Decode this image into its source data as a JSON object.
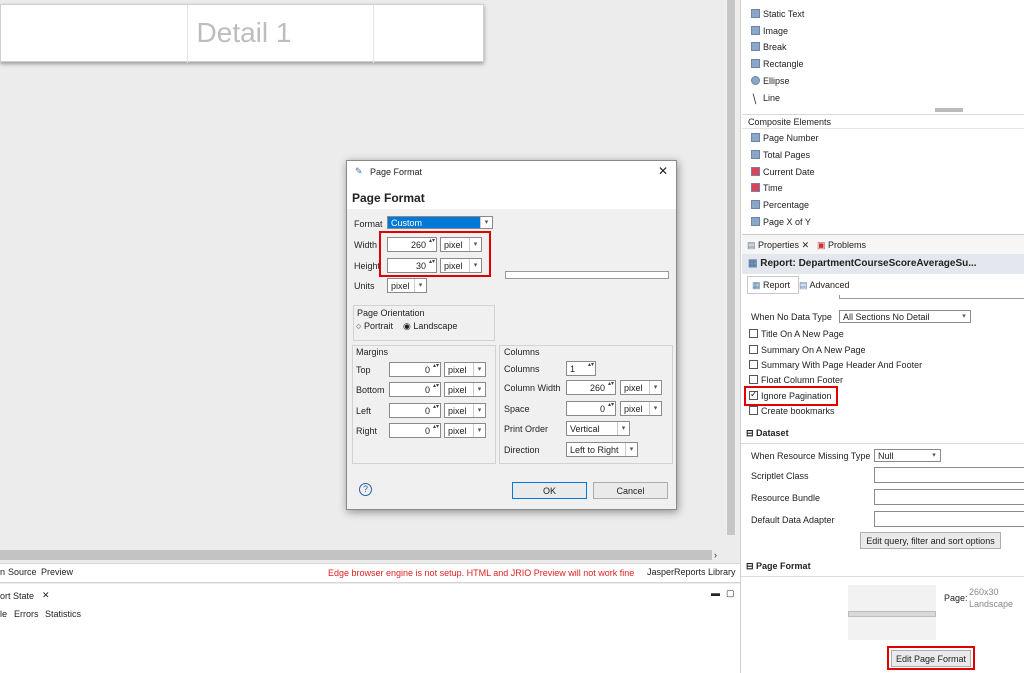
{
  "design": {
    "band_label": "Detail 1"
  },
  "editor_tabs": {
    "main_partial": "n",
    "source": "Source",
    "preview": "Preview",
    "warning": "Edge browser engine is not setup. HTML and JRIO Preview will not work fine",
    "library": "JasperReports Library"
  },
  "lower_panel": {
    "title": "ort State",
    "close": "✕",
    "sub_partial": "le",
    "errors": "Errors",
    "statistics": "Statistics"
  },
  "palette": {
    "items": [
      "Static Text",
      "Image",
      "Break",
      "Rectangle",
      "Ellipse",
      "Line"
    ],
    "composite_header": "Composite Elements",
    "composite": [
      "Page Number",
      "Total Pages",
      "Current Date",
      "Time",
      "Percentage",
      "Page X of Y"
    ]
  },
  "props": {
    "properties_tab": "Properties",
    "problems_tab": "Problems",
    "report_title": "Report: DepartmentCourseScoreAverageSu...",
    "report_tab": "Report",
    "advanced_tab": "Advanced",
    "when_no_data_label": "When No Data Type",
    "when_no_data_value": "All Sections No Detail",
    "checks": [
      {
        "label": "Title On A New Page",
        "checked": false
      },
      {
        "label": "Summary On A New Page",
        "checked": false
      },
      {
        "label": "Summary With Page Header And Footer",
        "checked": false
      },
      {
        "label": "Float Column Footer",
        "checked": false
      },
      {
        "label": "Ignore Pagination",
        "checked": true
      },
      {
        "label": "Create bookmarks",
        "checked": false
      }
    ],
    "dataset_header": "Dataset",
    "missing_label": "When Resource Missing Type",
    "missing_value": "Null",
    "scriptlet_label": "Scriptlet Class",
    "bundle_label": "Resource Bundle",
    "adapter_label": "Default Data Adapter",
    "edit_query_button": "Edit query, filter and sort options",
    "page_format_header": "Page Format",
    "page_label": "Page:",
    "page_size": "260x30",
    "page_orient": "Landscape",
    "edit_page_format_button": "Edit Page Format"
  },
  "dialog": {
    "title": "Page Format",
    "heading": "Page Format",
    "format_label": "Format",
    "format_value": "Custom",
    "width_label": "Width",
    "width_value": "260",
    "height_label": "Height",
    "height_value": "30",
    "unit_pixel": "pixel",
    "units_label": "Units",
    "units_value": "pixel",
    "orientation_label": "Page Orientation",
    "portrait": "Portrait",
    "landscape": "Landscape",
    "margins_label": "Margins",
    "top_label": "Top",
    "bottom_label": "Bottom",
    "left_label": "Left",
    "right_label": "Right",
    "margin_value": "0",
    "columns_group": "Columns",
    "columns_label": "Columns",
    "columns_value": "1",
    "colwidth_label": "Column Width",
    "colwidth_value": "260",
    "space_label": "Space",
    "space_value": "0",
    "print_order_label": "Print Order",
    "print_order_value": "Vertical",
    "direction_label": "Direction",
    "direction_value": "Left to Right",
    "ok": "OK",
    "cancel": "Cancel"
  },
  "colors": {
    "accent": "#0078d7",
    "highlight": "#e00000"
  }
}
